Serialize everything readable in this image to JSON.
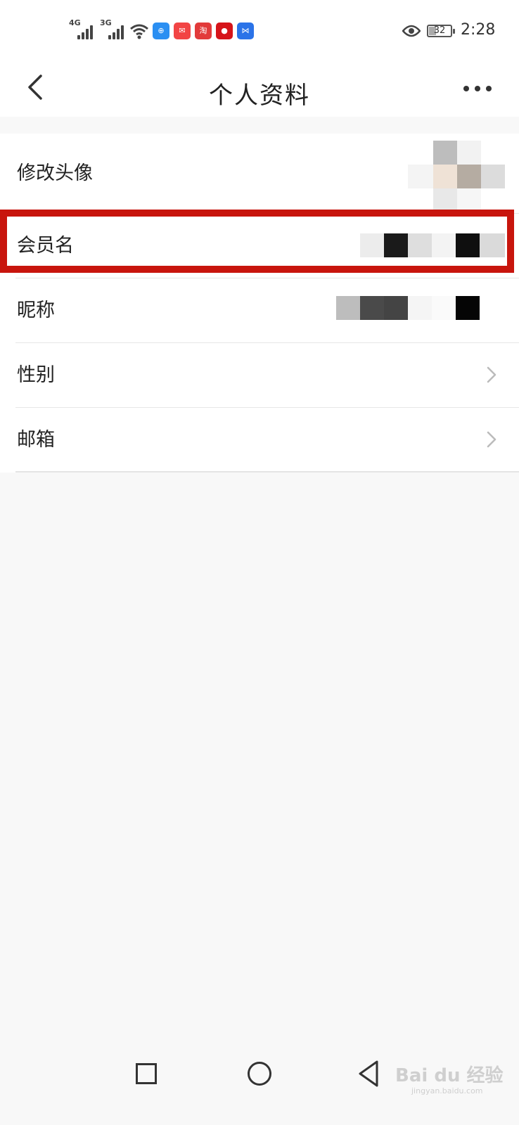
{
  "status_bar": {
    "signal_1_label": "4G",
    "signal_2_label": "3G",
    "battery_level": "32",
    "time": "2:28",
    "app_icons": [
      "app-icon-1",
      "app-icon-2",
      "app-icon-3",
      "app-icon-4",
      "app-icon-5"
    ],
    "app_icon_colors": [
      "#2b8ff2",
      "#f24444",
      "#e23a3a",
      "#d6141a",
      "#2b73e8"
    ],
    "app_icon_3_text": "淘"
  },
  "header": {
    "title": "个人资料",
    "back_icon": "chevron-left-icon",
    "more_icon": "more-horizontal-icon"
  },
  "profile_rows": [
    {
      "label": "修改头像",
      "value_type": "pixelated-avatar"
    },
    {
      "label": "会员名",
      "value_type": "pixelated-text",
      "highlighted": true
    },
    {
      "label": "昵称",
      "value_type": "pixelated-text"
    },
    {
      "label": "性别",
      "value_type": "chevron"
    },
    {
      "label": "邮箱",
      "value_type": "chevron"
    }
  ],
  "colors": {
    "highlight_border": "#c8150d",
    "page_background": "#f8f8f8",
    "list_background": "#ffffff"
  },
  "navbar": {
    "recent_icon": "square-icon",
    "home_icon": "circle-icon",
    "back_icon": "triangle-back-icon"
  },
  "watermark": {
    "text": "Bai du 经验",
    "sub": "jingyan.baidu.com"
  }
}
